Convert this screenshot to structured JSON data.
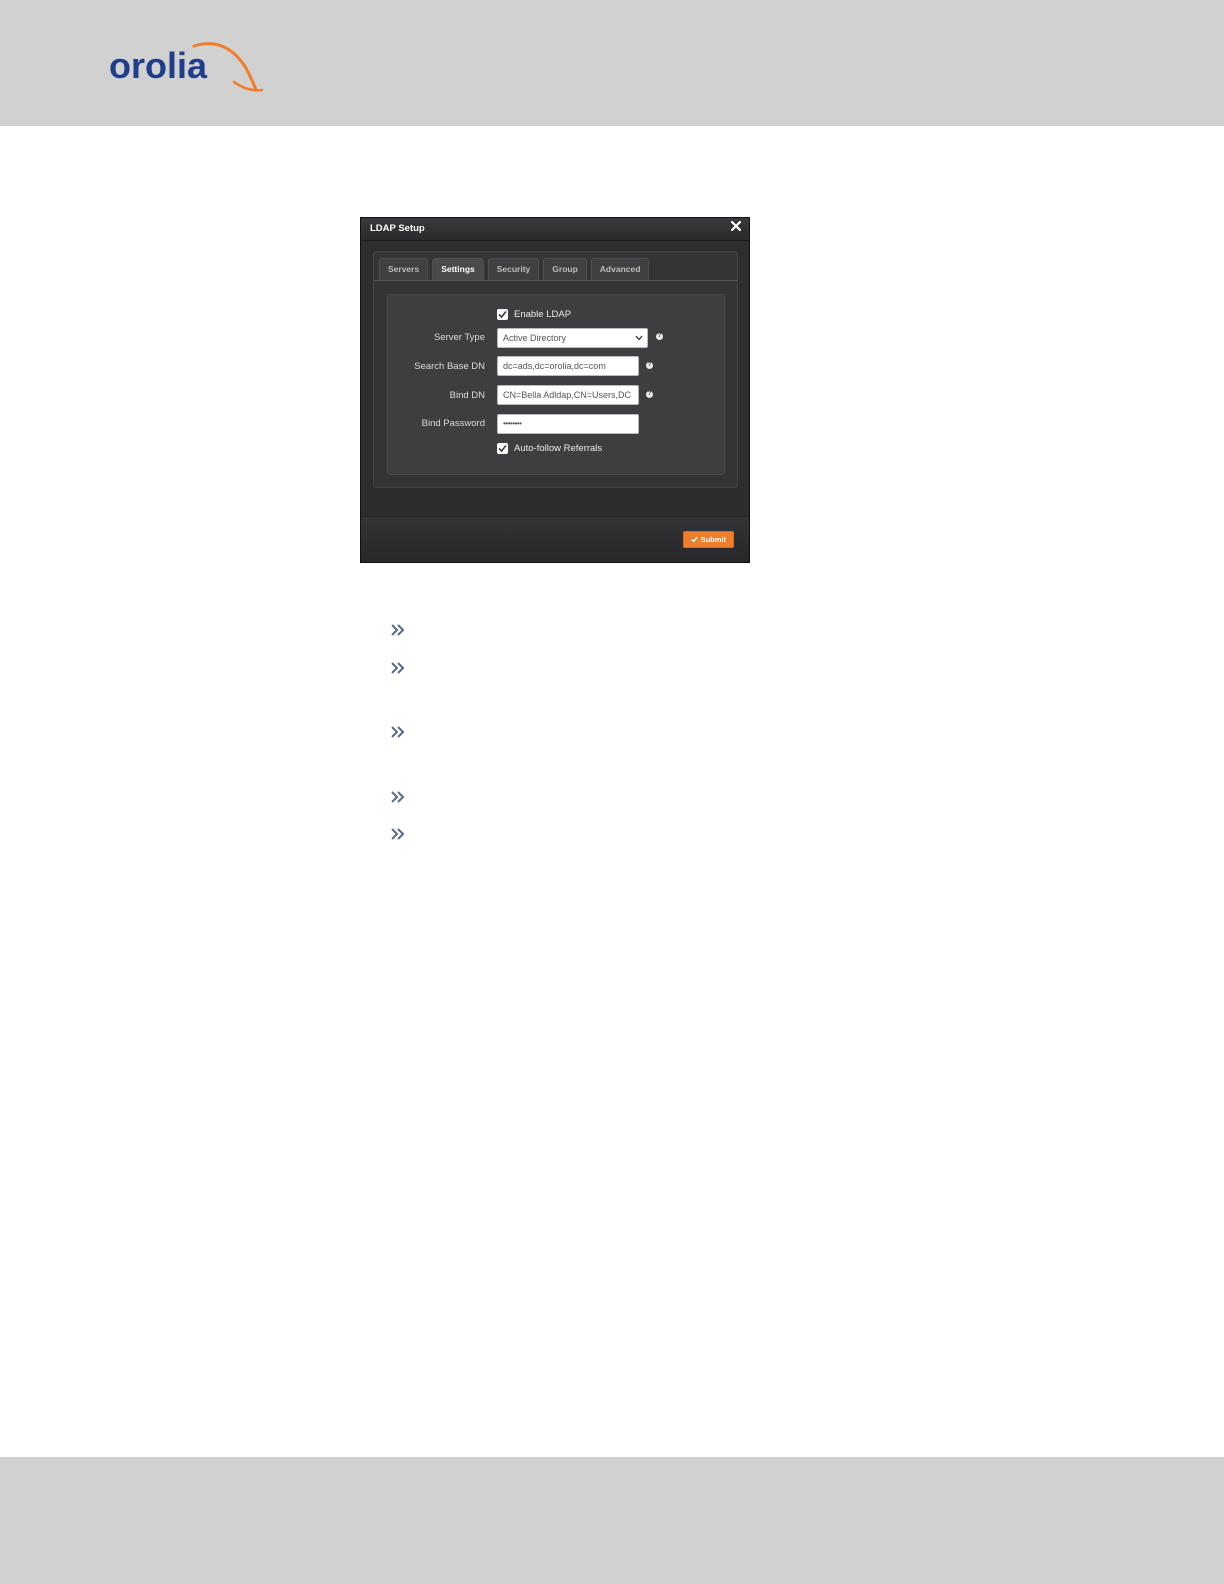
{
  "brand": {
    "logo_text": "orolia",
    "primary": "#1f3f8a",
    "accent": "#f07d2a"
  },
  "dialog": {
    "title": "LDAP Setup",
    "tabs": [
      {
        "label": "Servers",
        "active": false
      },
      {
        "label": "Settings",
        "active": true
      },
      {
        "label": "Security",
        "active": false
      },
      {
        "label": "Group",
        "active": false
      },
      {
        "label": "Advanced",
        "active": false
      }
    ],
    "enable_ldap": {
      "label": "Enable LDAP",
      "checked": true
    },
    "server_type": {
      "label": "Server Type",
      "value": "Active Directory"
    },
    "search_base_dn": {
      "label": "Search Base DN",
      "value": "dc=ads,dc=orolia,dc=com"
    },
    "bind_dn": {
      "label": "Bind DN",
      "value": "CN=Bella Adldap,CN=Users,DC"
    },
    "bind_password": {
      "label": "Bind Password",
      "value": "••••••••"
    },
    "auto_follow": {
      "label": "Auto-follow Referrals",
      "checked": true
    },
    "submit_label": "Submit",
    "help_glyph": "?"
  },
  "bullets": [
    "double-chevron-icon",
    "double-chevron-icon",
    "double-chevron-icon",
    "double-chevron-icon",
    "double-chevron-icon"
  ]
}
